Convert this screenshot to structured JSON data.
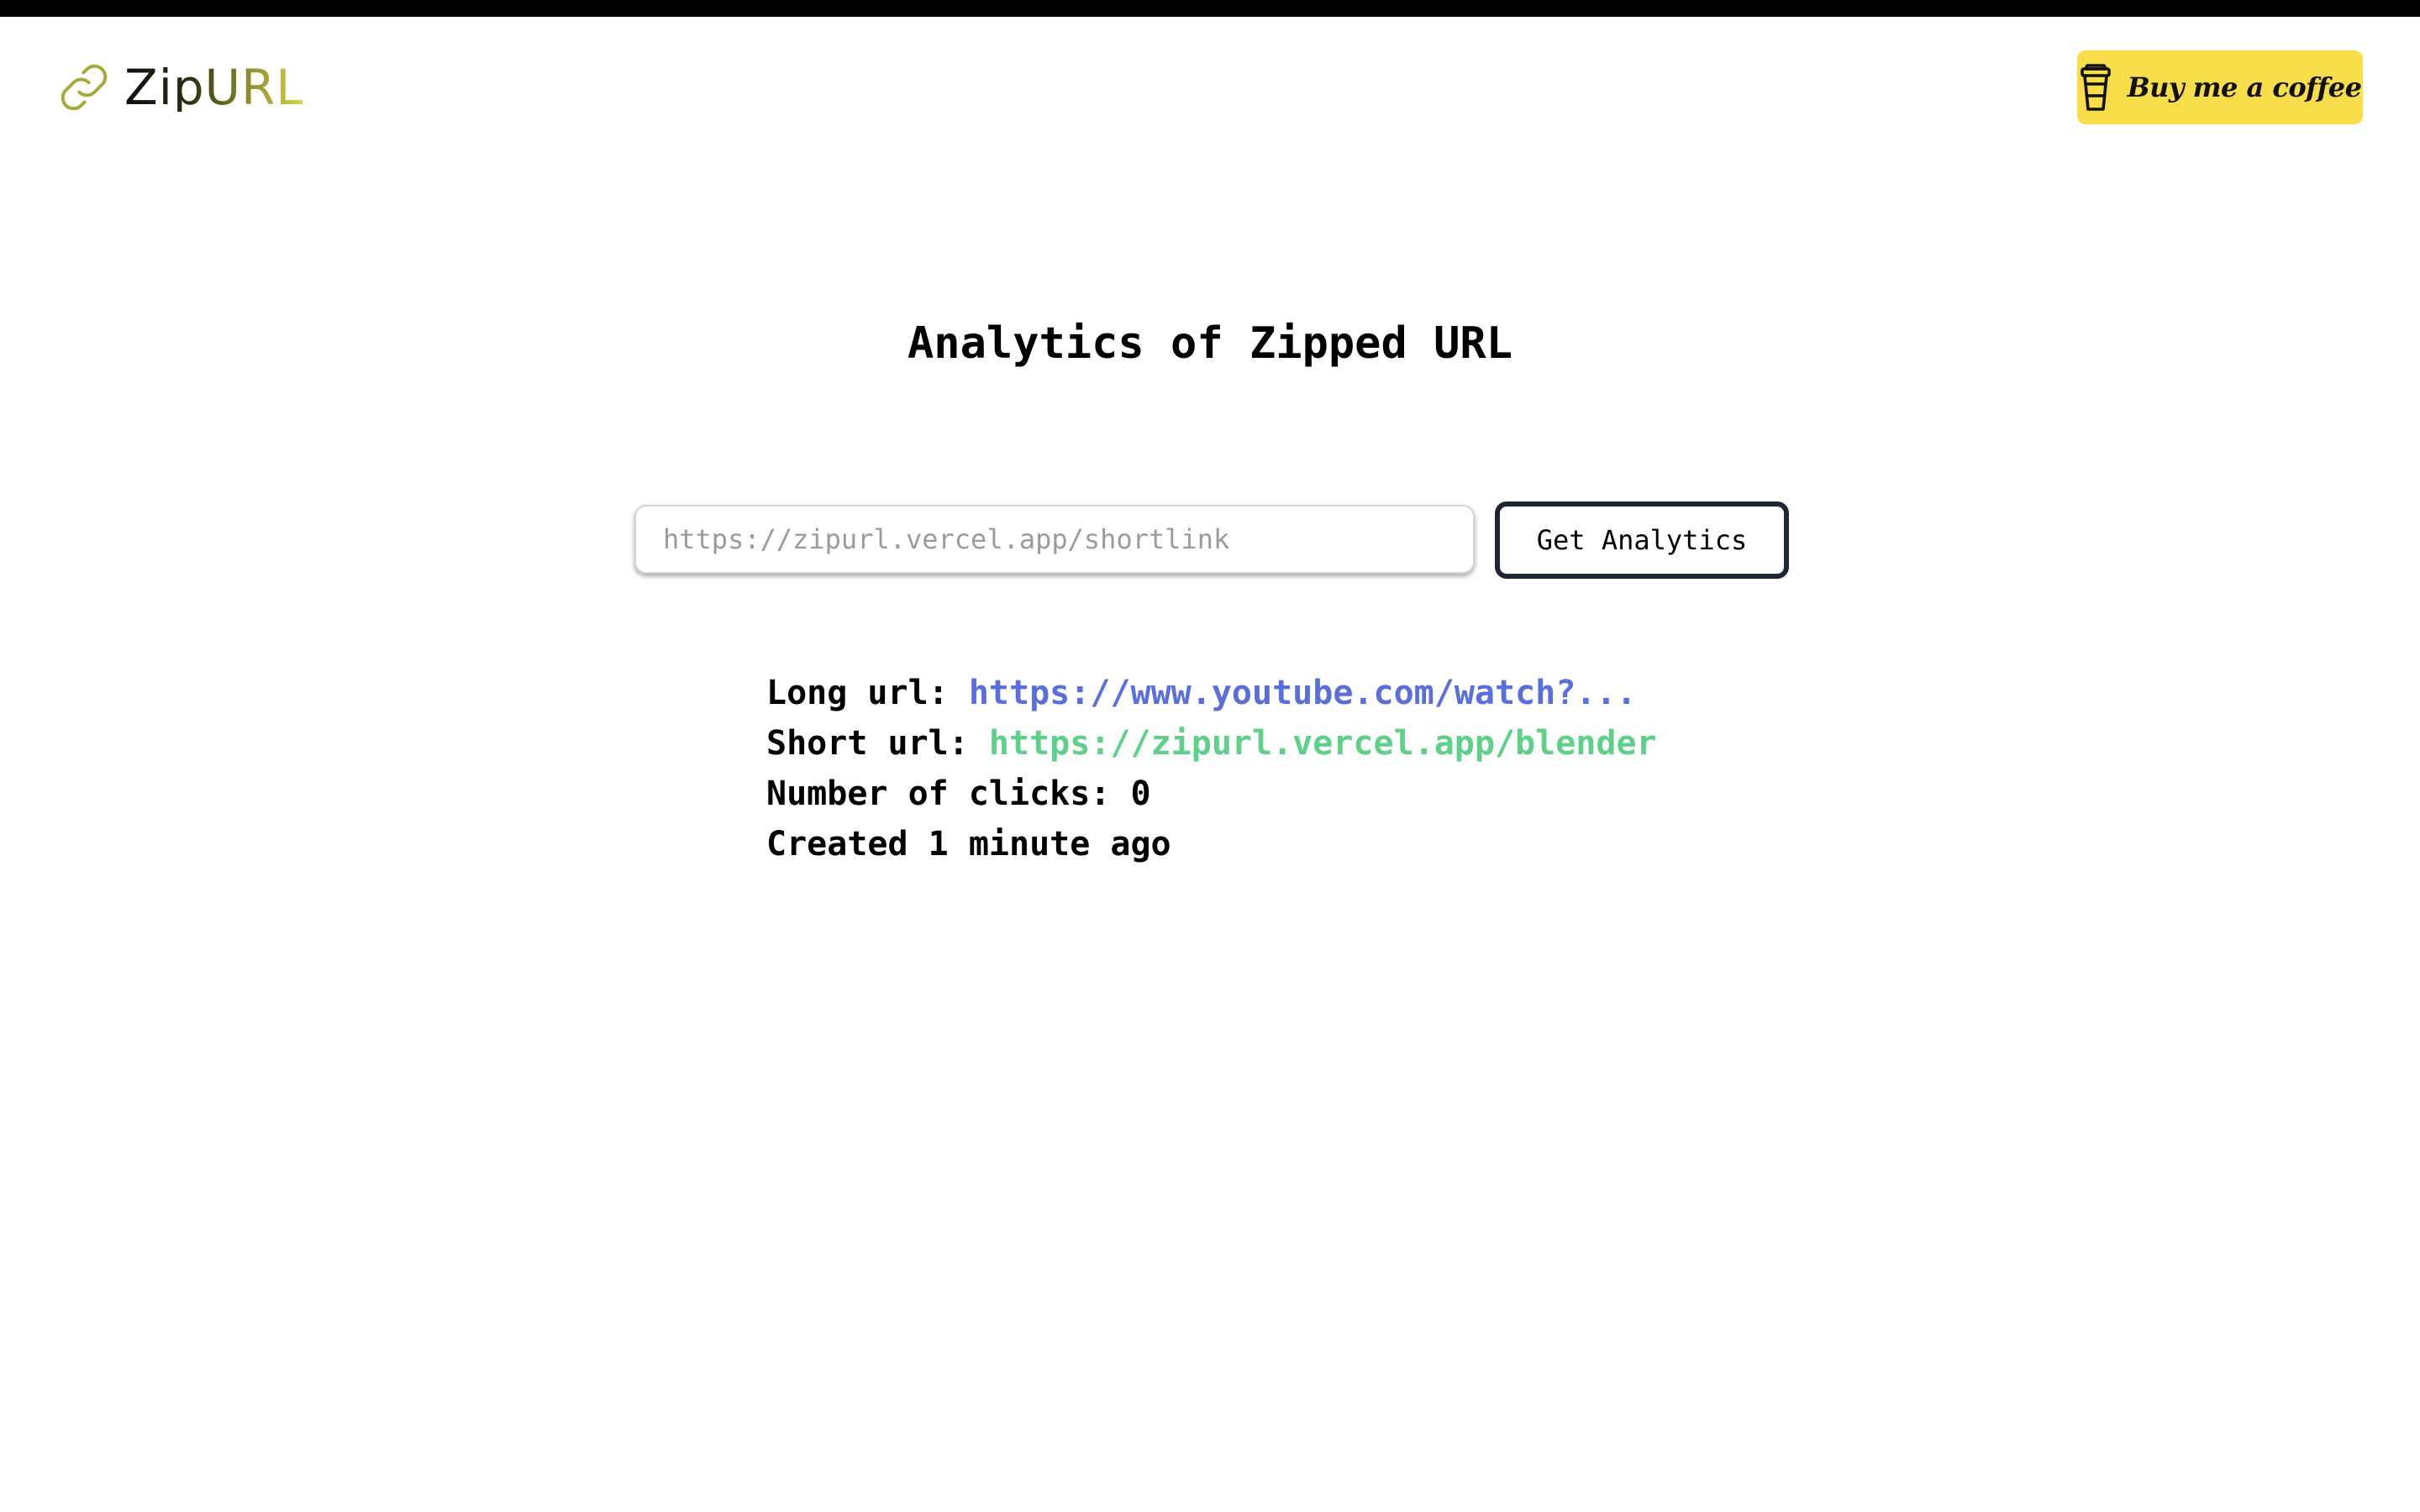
{
  "header": {
    "logo": {
      "icon": "link-icon",
      "text": "ZipURL"
    },
    "coffee_button": {
      "icon": "coffee-cup-icon",
      "label": "Buy me a coffee",
      "color": "#f8dd4b"
    }
  },
  "main": {
    "title": "Analytics of Zipped URL",
    "search": {
      "value": "",
      "placeholder": "https://zipurl.vercel.app/shortlink"
    },
    "get_analytics_label": "Get Analytics",
    "results": {
      "long_url_label": "Long url:",
      "long_url_value": "https://www.youtube.com/watch?...",
      "short_url_label": "Short url:",
      "short_url_value": "https://zipurl.vercel.app/blender",
      "clicks_label": "Number of clicks:",
      "clicks_value": "0",
      "created_text": "Created 1 minute ago"
    }
  },
  "colors": {
    "long_url": "#5b6fdc",
    "short_url": "#5fd08a",
    "button_border": "#1f2633",
    "top_strip": "#000000"
  }
}
